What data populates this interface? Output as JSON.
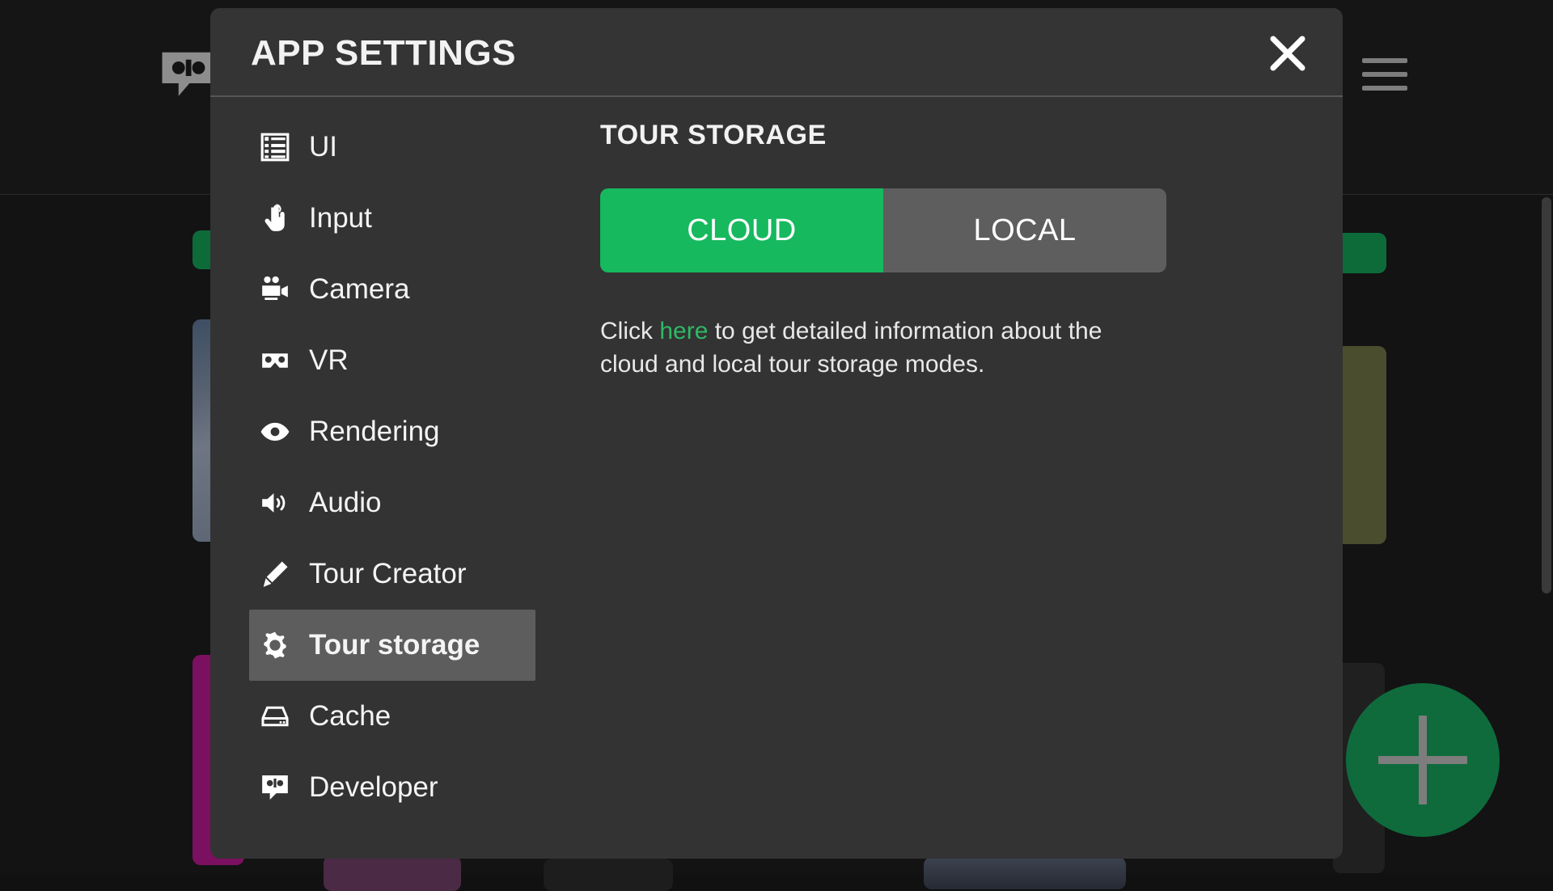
{
  "background": {
    "logo_icon": "vr-speech-bubble-logo",
    "menu_icon": "hamburger-menu-icon",
    "add_button_icon": "plus-icon"
  },
  "modal": {
    "title": "APP SETTINGS",
    "close_icon": "close-icon",
    "nav": {
      "items": [
        {
          "label": "UI",
          "icon": "list-layout-icon",
          "selected": false
        },
        {
          "label": "Input",
          "icon": "pointing-hand-icon",
          "selected": false
        },
        {
          "label": "Camera",
          "icon": "movie-camera-icon",
          "selected": false
        },
        {
          "label": "VR",
          "icon": "vr-goggles-icon",
          "selected": false
        },
        {
          "label": "Rendering",
          "icon": "eye-icon",
          "selected": false
        },
        {
          "label": "Audio",
          "icon": "speaker-volume-icon",
          "selected": false
        },
        {
          "label": "Tour Creator",
          "icon": "pencil-icon",
          "selected": false
        },
        {
          "label": "Tour storage",
          "icon": "gear-icon",
          "selected": true
        },
        {
          "label": "Cache",
          "icon": "hard-drive-icon",
          "selected": false
        },
        {
          "label": "Developer",
          "icon": "vr-speech-bubble-icon",
          "selected": false
        }
      ]
    },
    "content": {
      "section_title": "TOUR STORAGE",
      "toggle": {
        "options": [
          {
            "label": "CLOUD",
            "active": true
          },
          {
            "label": "LOCAL",
            "active": false
          }
        ]
      },
      "description": {
        "before_link": "Click ",
        "link_text": "here",
        "after_link": " to get detailed information about the cloud and local tour storage modes."
      }
    }
  },
  "colors": {
    "accent_green": "#16b95e",
    "link_green": "#2fb866",
    "modal_bg": "#333333",
    "selected_item": "#5d5d5d",
    "toggle_inactive": "#5e5e5e",
    "fab_green": "#0f6b3c"
  }
}
